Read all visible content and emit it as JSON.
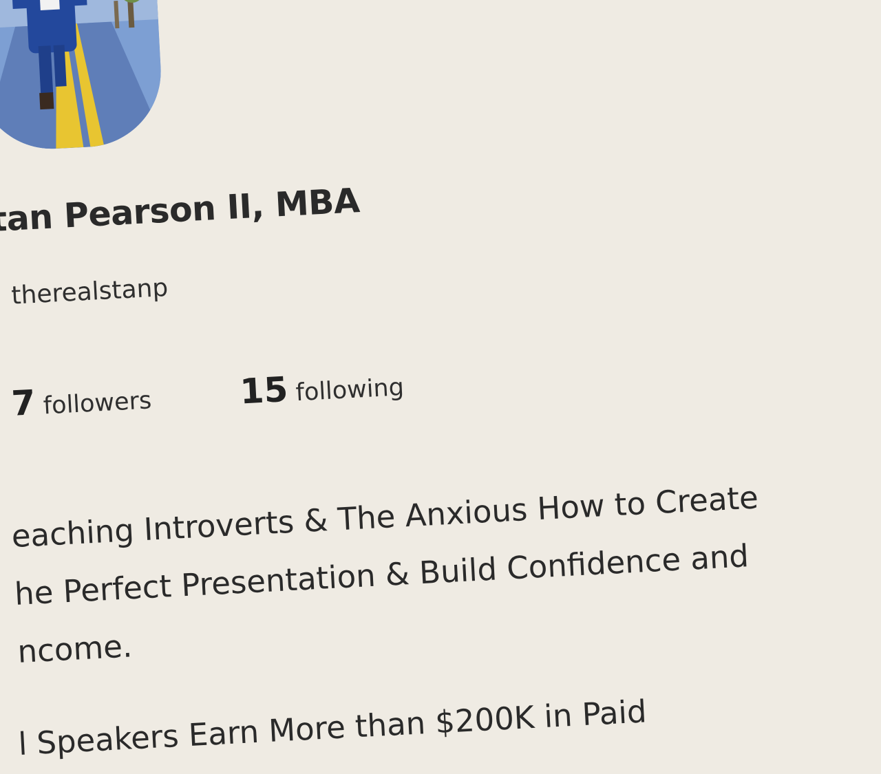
{
  "profile": {
    "avatar_alt": "profile photo of person running on street",
    "name": "tan Pearson II, MBA",
    "handle": "therealstanp",
    "followers": {
      "count": "7",
      "label": "followers"
    },
    "following": {
      "count": "15",
      "label": "following"
    },
    "bio_lines": [
      "eaching Introverts & The Anxious How to Create",
      "he Perfect Presentation & Build Confidence and",
      "ncome."
    ],
    "bio_partial": "l Speakers Earn More than $200K in Paid"
  },
  "colors": {
    "background": "#efebe3",
    "text": "#2a2a2a"
  }
}
